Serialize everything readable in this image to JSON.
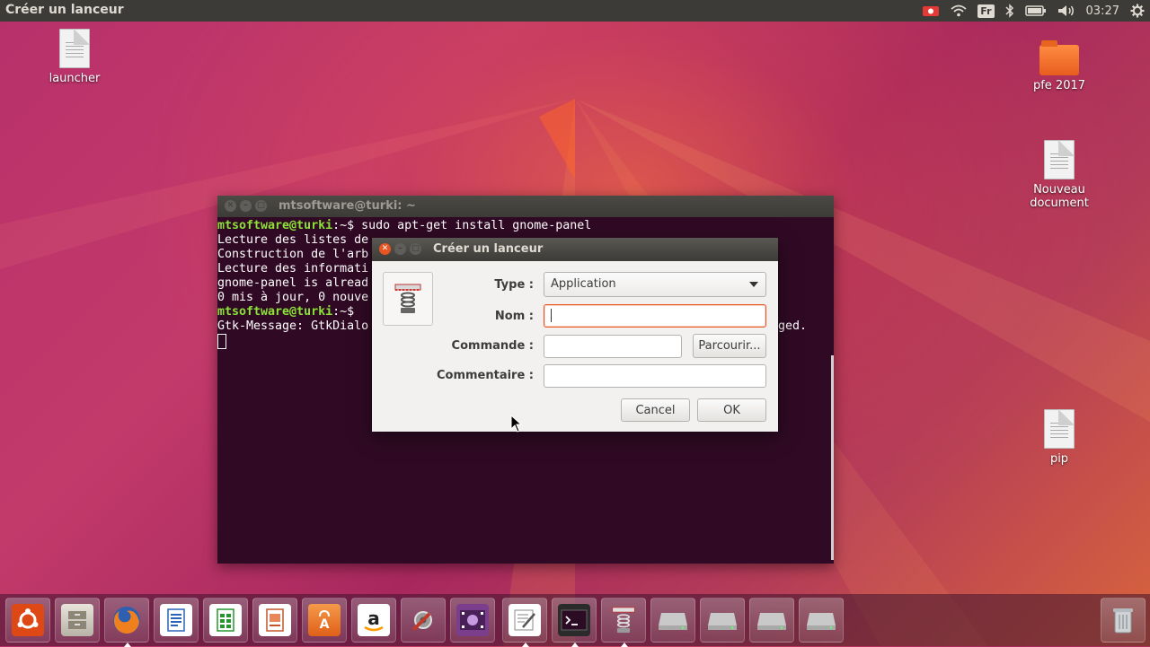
{
  "top_panel": {
    "title": "Créer un lanceur",
    "keyboard_layout": "Fr",
    "clock": "03:27"
  },
  "desktop": {
    "icons": [
      {
        "label": "launcher",
        "kind": "document"
      },
      {
        "label": "pfe 2017",
        "kind": "folder"
      },
      {
        "label": "Nouveau document",
        "kind": "document"
      },
      {
        "label": "pip",
        "kind": "document"
      }
    ]
  },
  "terminal": {
    "title": "mtsoftware@turki: ~",
    "lines": [
      {
        "prompt": "mtsoftware@turki",
        "rest": ":~$ sudo apt-get install gnome-panel"
      },
      {
        "prompt": "",
        "rest": "Lecture des listes de"
      },
      {
        "prompt": "",
        "rest": "Construction de l'arb"
      },
      {
        "prompt": "",
        "rest": "Lecture des informati"
      },
      {
        "prompt": "",
        "rest": "gnome-panel is alread"
      },
      {
        "prompt": "",
        "rest": "0 mis à jour, 0 nouve"
      },
      {
        "prompt": "mtsoftware@turki",
        "rest": ":~$ "
      },
      {
        "prompt": "",
        "rest": "Gtk-Message: GtkDialo"
      }
    ],
    "overflow_right": "ged."
  },
  "dialog": {
    "title": "Créer un lanceur",
    "type_label": "Type :",
    "type_value": "Application",
    "name_label": "Nom :",
    "name_value": "",
    "command_label": "Commande :",
    "command_value": "",
    "browse_label": "Parcourir...",
    "comment_label": "Commentaire :",
    "comment_value": "",
    "cancel_label": "Cancel",
    "ok_label": "OK"
  },
  "dock": {
    "items": [
      {
        "name": "ubuntu-dash",
        "icon": "ubuntu-logo-icon",
        "running": false
      },
      {
        "name": "files",
        "icon": "file-cabinet-icon",
        "running": false
      },
      {
        "name": "firefox",
        "icon": "firefox-icon",
        "running": true
      },
      {
        "name": "writer",
        "icon": "writer-icon",
        "running": false
      },
      {
        "name": "calc",
        "icon": "calc-icon",
        "running": false
      },
      {
        "name": "impress",
        "icon": "impress-icon",
        "running": false
      },
      {
        "name": "software-center",
        "icon": "shopping-bag-icon",
        "running": false
      },
      {
        "name": "amazon",
        "icon": "amazon-icon",
        "running": false
      },
      {
        "name": "system-settings",
        "icon": "settings-icon",
        "running": false
      },
      {
        "name": "video",
        "icon": "film-icon",
        "running": false
      },
      {
        "name": "text-editor",
        "icon": "text-editor-icon",
        "running": true
      },
      {
        "name": "terminal",
        "icon": "terminal-icon",
        "running": true
      },
      {
        "name": "launcher-creator",
        "icon": "spring-launcher-icon",
        "running": true
      },
      {
        "name": "drive-1",
        "icon": "drive-icon",
        "running": false
      },
      {
        "name": "drive-2",
        "icon": "drive-icon",
        "running": false
      },
      {
        "name": "drive-3",
        "icon": "drive-icon",
        "running": false
      },
      {
        "name": "drive-4",
        "icon": "drive-icon",
        "running": false
      },
      {
        "name": "trash",
        "icon": "trash-icon",
        "running": false
      }
    ]
  },
  "colors": {
    "accent": "#e95420",
    "terminal_bg": "#300a24",
    "prompt_green": "#8ae234",
    "panel": "#3c3b37"
  }
}
